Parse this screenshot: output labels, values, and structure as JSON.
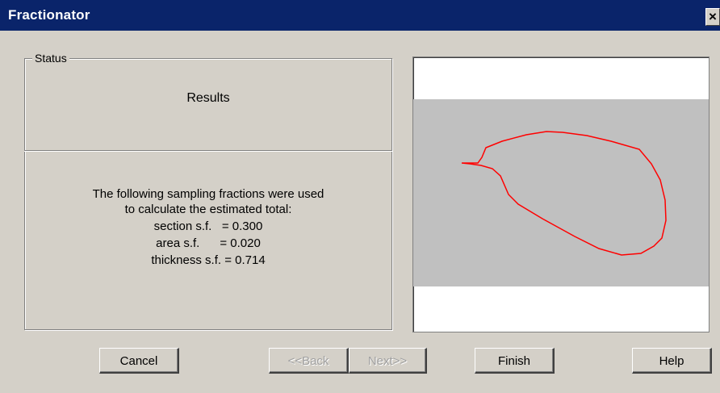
{
  "window": {
    "title": "Fractionator",
    "close_label": "×"
  },
  "status": {
    "legend": "Status",
    "results_title": "Results",
    "lines": [
      "The following sampling fractions were used",
      "to calculate the estimated total:",
      "section s.f.   = 0.300",
      "area s.f.      = 0.020",
      "thickness s.f. = 0.714"
    ]
  },
  "preview": {
    "contour_color": "#ff0000"
  },
  "buttons": {
    "cancel": "Cancel",
    "back": "<<Back",
    "next": "Next>>",
    "finish": "Finish",
    "help": "Help"
  }
}
